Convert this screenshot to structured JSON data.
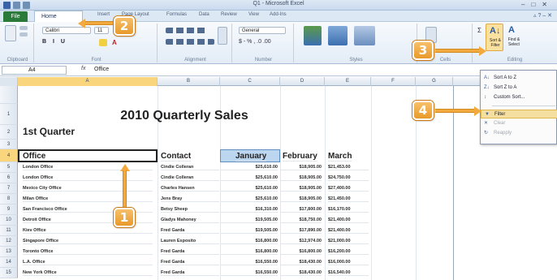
{
  "app": {
    "title": "Q1 - Microsoft Excel"
  },
  "tabs": {
    "file": "File",
    "home": "Home",
    "others": [
      "Insert",
      "Page Layout",
      "Formulas",
      "Data",
      "Review",
      "View",
      "Add-Ins"
    ]
  },
  "ribbon": {
    "groups": [
      "Clipboard",
      "Font",
      "Alignment",
      "Number",
      "Styles",
      "Cells",
      "Editing"
    ],
    "font_name": "Calibri",
    "font_size": "11",
    "number_format": "General",
    "sort_filter_label": "Sort & Filter",
    "find_select_label": "Find & Select"
  },
  "formula_bar": {
    "name_box": "A4",
    "fx": "fx",
    "content": "Office"
  },
  "columns": [
    "A",
    "B",
    "C",
    "D",
    "E",
    "F",
    "G",
    "H"
  ],
  "sheet": {
    "title": "2010 Quarterly Sales",
    "subtitle": "1st Quarter",
    "headers": [
      "Office",
      "Contact",
      "January",
      "February",
      "March"
    ],
    "rows": [
      {
        "num": "5",
        "office": "London Office",
        "contact": "Cindie Colleran",
        "jan": "$25,610.00",
        "feb": "$18,905.00",
        "mar": "$21,453.00"
      },
      {
        "num": "6",
        "office": "London Office",
        "contact": "Cindie Colleran",
        "jan": "$25,610.00",
        "feb": "$18,905.00",
        "mar": "$24,750.00"
      },
      {
        "num": "7",
        "office": "Mexico City Office",
        "contact": "Charles Hansen",
        "jan": "$25,610.00",
        "feb": "$18,905.00",
        "mar": "$27,400.00"
      },
      {
        "num": "8",
        "office": "Milan Office",
        "contact": "Jens Bray",
        "jan": "$25,610.00",
        "feb": "$18,905.00",
        "mar": "$21,450.00"
      },
      {
        "num": "9",
        "office": "San Francisco Office",
        "contact": "Betsy Sheep",
        "jan": "$16,310.00",
        "feb": "$17,800.00",
        "mar": "$16,170.00"
      },
      {
        "num": "10",
        "office": "Detroit Office",
        "contact": "Gladys Mahoney",
        "jan": "$19,505.00",
        "feb": "$18,750.00",
        "mar": "$21,400.00"
      },
      {
        "num": "11",
        "office": "Kiev Office",
        "contact": "Fred Garda",
        "jan": "$19,505.00",
        "feb": "$17,890.00",
        "mar": "$21,400.00"
      },
      {
        "num": "12",
        "office": "Singapore Office",
        "contact": "Lauren Esposito",
        "jan": "$16,800.00",
        "feb": "$12,974.00",
        "mar": "$21,000.00"
      },
      {
        "num": "13",
        "office": "Toronto Office",
        "contact": "Fred Garda",
        "jan": "$16,800.00",
        "feb": "$16,800.00",
        "mar": "$16,200.00"
      },
      {
        "num": "14",
        "office": "L.A. Office",
        "contact": "Fred Garda",
        "jan": "$16,550.00",
        "feb": "$18,430.00",
        "mar": "$16,000.00"
      },
      {
        "num": "15",
        "office": "New York Office",
        "contact": "Fred Garda",
        "jan": "$16,550.00",
        "feb": "$18,430.00",
        "mar": "$16,540.00"
      }
    ]
  },
  "row_numbers": [
    "1",
    "2",
    "3",
    "4"
  ],
  "dropdown": {
    "items": [
      {
        "label": "Sort A to Z",
        "icon": "A↓",
        "disabled": false,
        "highlight": false
      },
      {
        "label": "Sort Z to A",
        "icon": "Z↓",
        "disabled": false,
        "highlight": false
      },
      {
        "label": "Custom Sort...",
        "icon": "↕",
        "disabled": false,
        "highlight": false
      },
      {
        "label": "Filter",
        "icon": "▼",
        "disabled": false,
        "highlight": true
      },
      {
        "label": "Clear",
        "icon": "✕",
        "disabled": true,
        "highlight": false
      },
      {
        "label": "Reapply",
        "icon": "↻",
        "disabled": true,
        "highlight": false
      }
    ]
  },
  "callouts": [
    "1",
    "2",
    "3",
    "4"
  ],
  "colors": {
    "callout": "#f2a93e",
    "selected_header": "#f9d57e",
    "file_tab": "#2a7a3a"
  }
}
